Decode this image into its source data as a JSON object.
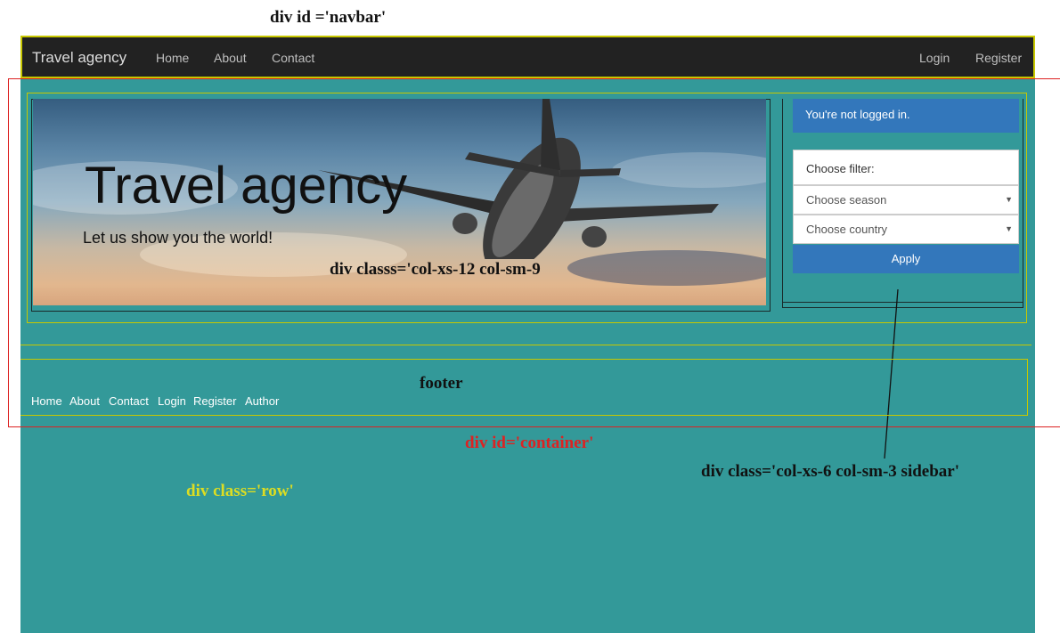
{
  "annotations": {
    "navbar": "div id ='navbar'",
    "col": "div classs='col-xs-12 col-sm-9",
    "footer": "footer",
    "container": "div id='container'",
    "sidebar": "div class='col-xs-6 col-sm-3 sidebar'",
    "row": "div class='row'"
  },
  "navbar": {
    "brand": "Travel agency",
    "links": [
      "Home",
      "About",
      "Contact"
    ],
    "right_links": [
      "Login",
      "Register"
    ]
  },
  "hero": {
    "title": "Travel agency",
    "subtitle": "Let us show you the world!"
  },
  "sidebar": {
    "alert": "You're not logged in.",
    "filter_label": "Choose filter:",
    "season_select": "Choose season",
    "country_select": "Choose country",
    "apply_label": "Apply"
  },
  "footer": {
    "links": [
      "Home",
      "About",
      "Contact",
      "Login",
      "Register",
      "Author"
    ]
  },
  "colors": {
    "background": "#339999",
    "navbar": "#222222",
    "primary": "#3377bb",
    "annotation_red": "#dd2222",
    "annotation_yellow": "#c8c800"
  }
}
